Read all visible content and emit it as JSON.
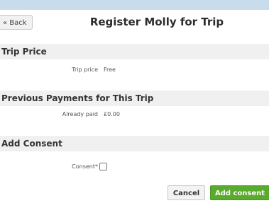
{
  "header": {
    "back_label": "« Back",
    "title": "Register Molly for Trip"
  },
  "sections": [
    {
      "heading": "Trip Price",
      "label": "Trip price",
      "value": "Free"
    },
    {
      "heading": "Previous Payments for This Trip",
      "label": "Already paid",
      "value": "£0.00"
    },
    {
      "heading": "Add Consent",
      "label": "Consent*",
      "checked": false
    }
  ],
  "actions": {
    "cancel_label": "Cancel",
    "submit_label": "Add consent"
  },
  "colors": {
    "topbar": "#c9dcec",
    "section_bg": "#f0f0f0",
    "primary": "#5aaa2d"
  }
}
